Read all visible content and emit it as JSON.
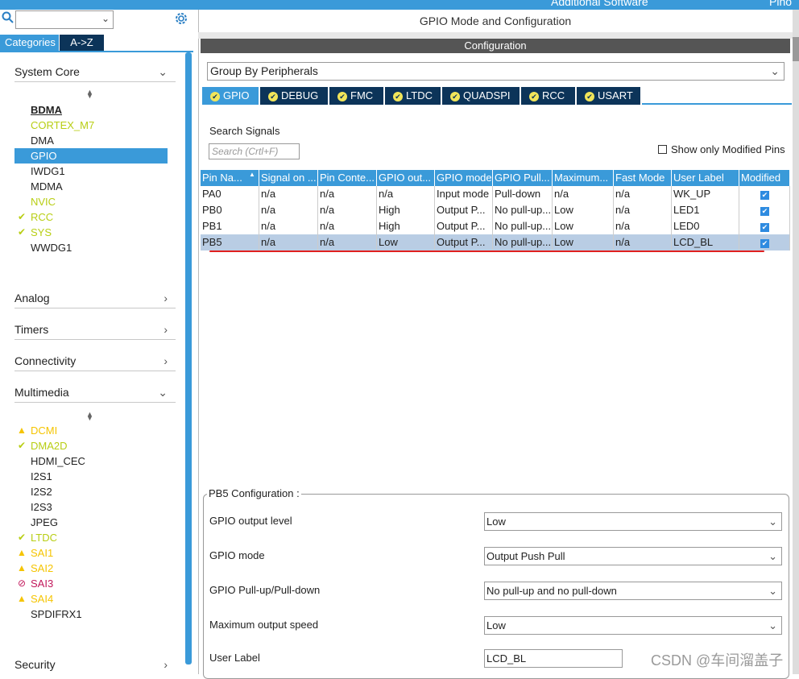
{
  "top_strip": {
    "left_text": "Additional Software",
    "right_text": "Pino"
  },
  "left": {
    "tab_categories": "Categories",
    "tab_az": "A->Z",
    "system_core": {
      "label": "System Core",
      "items": [
        {
          "label": "BDMA",
          "status": ""
        },
        {
          "label": "CORTEX_M7",
          "status": ""
        },
        {
          "label": "DMA",
          "status": ""
        },
        {
          "label": "GPIO",
          "status": ""
        },
        {
          "label": "IWDG1",
          "status": ""
        },
        {
          "label": "MDMA",
          "status": ""
        },
        {
          "label": "NVIC",
          "status": ""
        },
        {
          "label": "RCC",
          "status": "ok"
        },
        {
          "label": "SYS",
          "status": "ok"
        },
        {
          "label": "WWDG1",
          "status": ""
        }
      ]
    },
    "analog": "Analog",
    "timers": "Timers",
    "connectivity": "Connectivity",
    "multimedia": {
      "label": "Multimedia",
      "items": [
        {
          "label": "DCMI",
          "status": "warn"
        },
        {
          "label": "DMA2D",
          "status": "ok"
        },
        {
          "label": "HDMI_CEC",
          "status": ""
        },
        {
          "label": "I2S1",
          "status": ""
        },
        {
          "label": "I2S2",
          "status": ""
        },
        {
          "label": "I2S3",
          "status": ""
        },
        {
          "label": "JPEG",
          "status": ""
        },
        {
          "label": "LTDC",
          "status": "ok"
        },
        {
          "label": "SAI1",
          "status": "warn"
        },
        {
          "label": "SAI2",
          "status": "warn"
        },
        {
          "label": "SAI3",
          "status": "err"
        },
        {
          "label": "SAI4",
          "status": "warn"
        },
        {
          "label": "SPDIFRX1",
          "status": ""
        }
      ]
    },
    "security": "Security"
  },
  "right": {
    "mode_title": "GPIO Mode and Configuration",
    "config_label": "Configuration",
    "group_select": "Group By Peripherals",
    "tabs": [
      "GPIO",
      "DEBUG",
      "FMC",
      "LTDC",
      "QUADSPI",
      "RCC",
      "USART"
    ],
    "search_label": "Search Signals",
    "search_placeholder": "Search (Crtl+F)",
    "only_modified": "Show only Modified Pins",
    "table": {
      "headers": [
        "Pin Na...",
        "Signal on ...",
        "Pin Conte...",
        "GPIO out...",
        "GPIO mode",
        "GPIO Pull...",
        "Maximum...",
        "Fast Mode",
        "User Label",
        "Modified"
      ],
      "rows": [
        [
          "PA0",
          "n/a",
          "n/a",
          "n/a",
          "Input mode",
          "Pull-down",
          "n/a",
          "n/a",
          "WK_UP"
        ],
        [
          "PB0",
          "n/a",
          "n/a",
          "High",
          "Output P...",
          "No pull-up...",
          "Low",
          "n/a",
          "LED1"
        ],
        [
          "PB1",
          "n/a",
          "n/a",
          "High",
          "Output P...",
          "No pull-up...",
          "Low",
          "n/a",
          "LED0"
        ],
        [
          "PB5",
          "n/a",
          "n/a",
          "Low",
          "Output P...",
          "No pull-up...",
          "Low",
          "n/a",
          "LCD_BL"
        ]
      ],
      "modified": [
        true,
        true,
        true,
        true
      ],
      "selected_row": 3
    },
    "pb5": {
      "title": "PB5 Configuration :",
      "fields": [
        {
          "label": "GPIO output level",
          "value": "Low"
        },
        {
          "label": "GPIO mode",
          "value": "Output Push Pull"
        },
        {
          "label": "GPIO Pull-up/Pull-down",
          "value": "No pull-up and no pull-down"
        },
        {
          "label": "Maximum output speed",
          "value": "Low"
        },
        {
          "label": "User Label",
          "value": "LCD_BL"
        }
      ]
    }
  },
  "watermark": "CSDN @车间溜盖子",
  "colors": {
    "accent": "#3a9ad9",
    "dark_tab": "#0c3459",
    "ok": "#b8ce14",
    "warn": "#f5c400",
    "err": "#c2185b"
  }
}
